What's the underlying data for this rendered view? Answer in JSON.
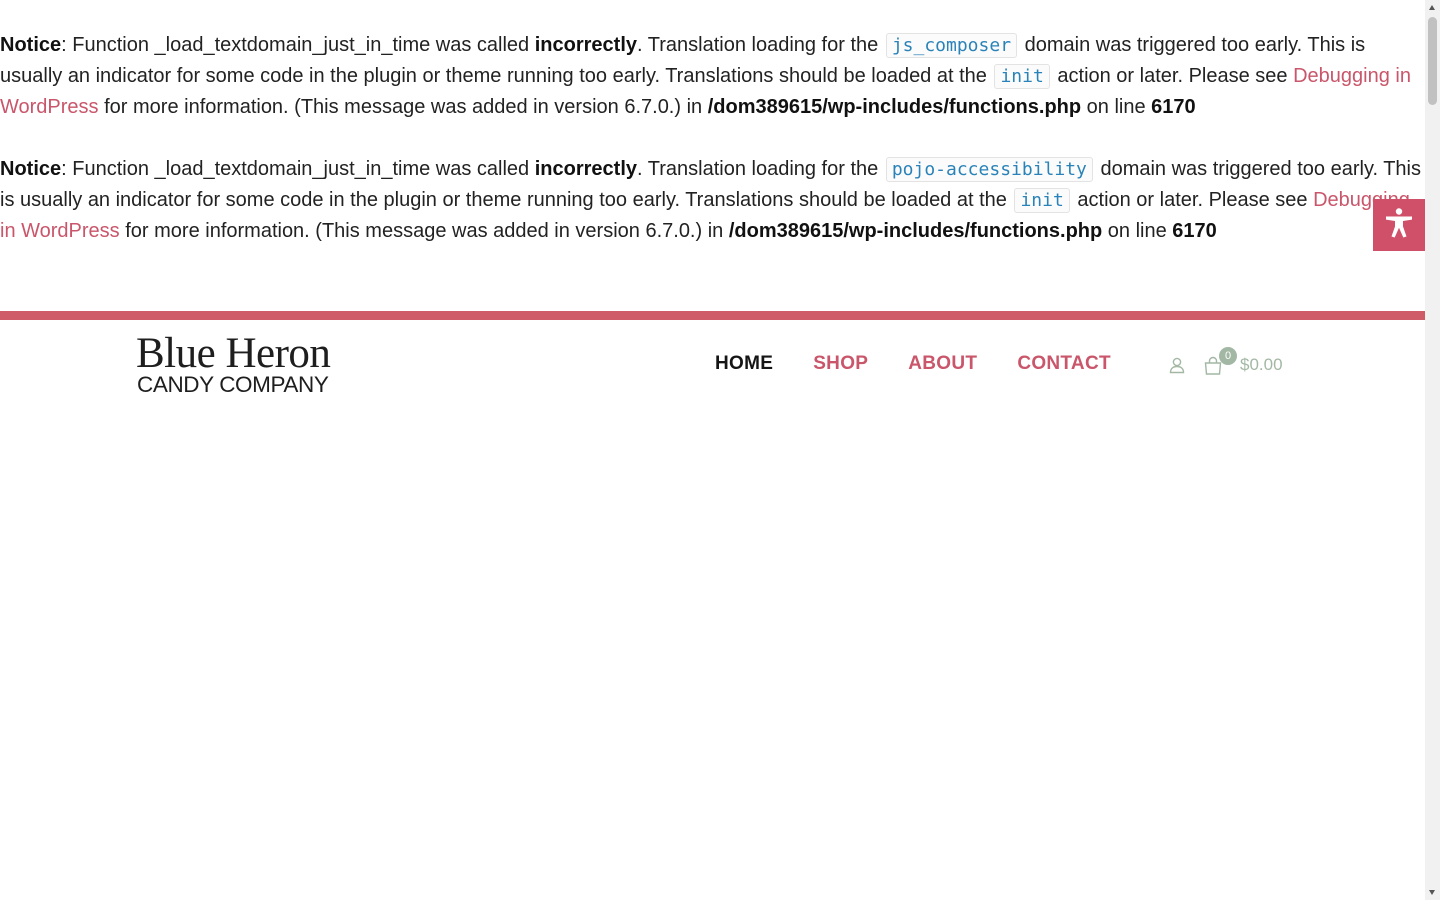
{
  "notices": [
    {
      "label": "Notice",
      "t1": ": Function _load_textdomain_just_in_time was called ",
      "emph": "incorrectly",
      "t2": ". Translation loading for the ",
      "domain_code": "js_composer",
      "t3": " domain was triggered too early. This is usually an indicator for some code in the plugin or theme running too early. Translations should be loaded at the ",
      "init_code": "init",
      "t4": " action or later. Please see ",
      "link_text": "Debugging in WordPress",
      "t5": " for more information. (This message was added in version 6.7.0.) in ",
      "file": "/dom389615/wp-includes/functions.php",
      "t6": " on line ",
      "line": "6170"
    },
    {
      "label": "Notice",
      "t1": ": Function _load_textdomain_just_in_time was called ",
      "emph": "incorrectly",
      "t2": ". Translation loading for the ",
      "domain_code": "pojo-accessibility",
      "t3": " domain was triggered too early. This is usually an indicator for some code in the plugin or theme running too early. Translations should be loaded at the ",
      "init_code": "init",
      "t4": " action or later. Please see ",
      "link_text": "Debugging in WordPress",
      "t5": " for more information. (This message was added in version 6.7.0.) in ",
      "file": "/dom389615/wp-includes/functions.php",
      "t6": " on line ",
      "line": "6170"
    }
  ],
  "header": {
    "logo_line1": "Blue Heron",
    "logo_line2": "CANDY COMPANY",
    "nav": [
      {
        "label": "HOME",
        "active": true
      },
      {
        "label": "SHOP",
        "active": false
      },
      {
        "label": "ABOUT",
        "active": false
      },
      {
        "label": "CONTACT",
        "active": false
      }
    ],
    "cart_count": "0",
    "cart_total": "$0.00"
  },
  "icons": {
    "account": "user-icon",
    "cart": "shopping-bag-icon",
    "accessibility": "accessibility-icon"
  },
  "colors": {
    "accent": "#cf5b68",
    "link": "#c9566a",
    "code": "#2a83b8",
    "cart": "#a3b8a4"
  }
}
